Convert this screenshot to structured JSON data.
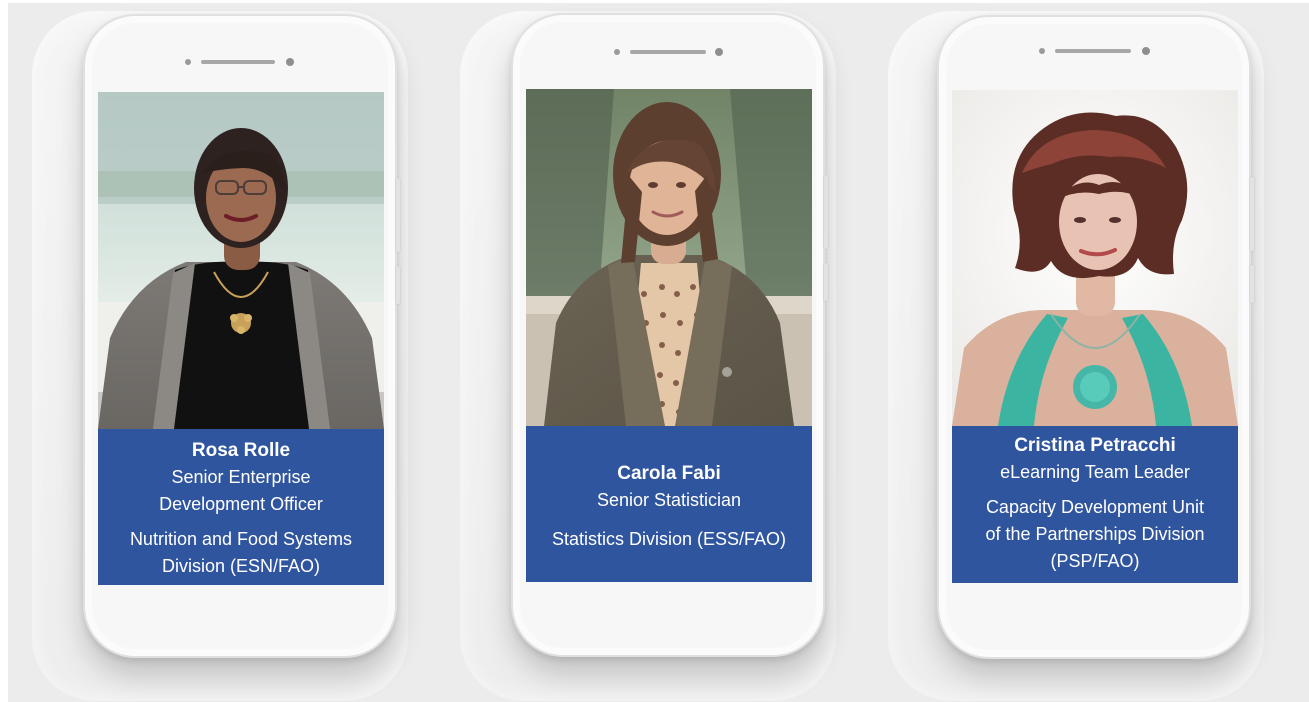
{
  "profiles": [
    {
      "name": "Rosa Rolle",
      "title_lines": [
        "Senior Enterprise",
        "Development Officer"
      ],
      "unit_lines": [
        "Nutrition and Food Systems",
        "Division (ESN/FAO)"
      ]
    },
    {
      "name": "Carola Fabi",
      "title_lines": [
        "Senior Statistician"
      ],
      "unit_lines": [
        "Statistics Division (ESS/FAO)"
      ]
    },
    {
      "name": "Cristina Petracchi",
      "title_lines": [
        "eLearning Team Leader"
      ],
      "unit_lines": [
        "Capacity Development Unit",
        "of the Partnerships Division",
        "(PSP/FAO)"
      ]
    }
  ],
  "colors": {
    "caption_bg": "#30559f",
    "background": "#ececec",
    "phone_body": "#f7f7f7"
  }
}
